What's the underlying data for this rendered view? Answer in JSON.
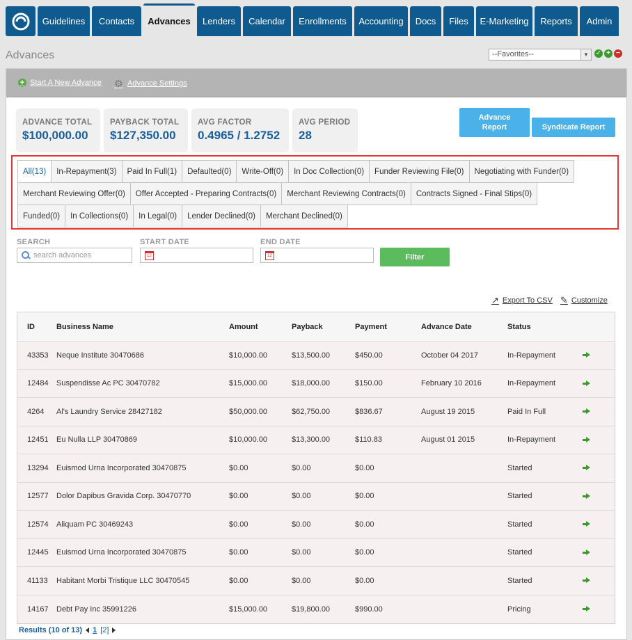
{
  "nav": {
    "tabs": [
      {
        "label": "Guidelines",
        "active": false
      },
      {
        "label": "Contacts",
        "active": false
      },
      {
        "label": "Advances",
        "active": true
      },
      {
        "label": "Lenders",
        "active": false
      },
      {
        "label": "Calendar",
        "active": false
      },
      {
        "label": "Enrollments",
        "active": false
      },
      {
        "label": "Accounting",
        "active": false
      },
      {
        "label": "Docs",
        "active": false
      },
      {
        "label": "Files",
        "active": false
      },
      {
        "label": "E-Marketing",
        "active": false
      },
      {
        "label": "Reports",
        "active": false
      },
      {
        "label": "Admin",
        "active": false
      }
    ]
  },
  "page": {
    "title": "Advances",
    "favorites_value": "--Favorites--"
  },
  "subbar": {
    "start_advance": "Start A New Advance",
    "advance_settings": "Advance Settings"
  },
  "stats": [
    {
      "label": "ADVANCE TOTAL",
      "value": "$100,000.00"
    },
    {
      "label": "PAYBACK TOTAL",
      "value": "$127,350.00"
    },
    {
      "label": "AVG FACTOR",
      "value": "0.4965 / 1.2752"
    },
    {
      "label": "AVG PERIOD",
      "value": "28"
    }
  ],
  "buttons": {
    "advance_report": "Advance Report",
    "syndicate_report": "Syndicate Report",
    "filter": "Filter"
  },
  "status_tabs": {
    "row1": [
      "All(13)",
      "In-Repayment(3)",
      "Paid In Full(1)",
      "Defaulted(0)",
      "Write-Off(0)",
      "In Doc Collection(0)",
      "Funder Reviewing File(0)",
      "Negotiating with Funder(0)"
    ],
    "row2": [
      "Merchant Reviewing Offer(0)",
      "Offer Accepted - Preparing Contracts(0)",
      "Merchant Reviewing Contracts(0)",
      "Contracts Signed - Final Stips(0)"
    ],
    "row3": [
      "Funded(0)",
      "In Collections(0)",
      "In Legal(0)",
      "Lender Declined(0)",
      "Merchant Declined(0)"
    ]
  },
  "filters": {
    "search_label": "SEARCH",
    "search_placeholder": "search advances",
    "start_label": "START DATE",
    "end_label": "END DATE"
  },
  "tools": {
    "export": "Export To CSV",
    "customize": "Customize"
  },
  "table": {
    "headers": {
      "id": "ID",
      "business": "Business Name",
      "amount": "Amount",
      "payback": "Payback",
      "payment": "Payment",
      "advance_date": "Advance Date",
      "status": "Status"
    },
    "rows": [
      {
        "id": "43353",
        "business": "Neque Institute 30470686",
        "amount": "$10,000.00",
        "payback": "$13,500.00",
        "payment": "$450.00",
        "date": "October 04 2017",
        "status": "In-Repayment"
      },
      {
        "id": "12484",
        "business": "Suspendisse Ac PC 30470782",
        "amount": "$15,000.00",
        "payback": "$18,000.00",
        "payment": "$150.00",
        "date": "February 10 2016",
        "status": "In-Repayment"
      },
      {
        "id": "4264",
        "business": "Al's Laundry Service 28427182",
        "amount": "$50,000.00",
        "payback": "$62,750.00",
        "payment": "$836.67",
        "date": "August 19 2015",
        "status": "Paid In Full"
      },
      {
        "id": "12451",
        "business": "Eu Nulla LLP 30470869",
        "amount": "$10,000.00",
        "payback": "$13,300.00",
        "payment": "$110.83",
        "date": "August 01 2015",
        "status": "In-Repayment"
      },
      {
        "id": "13294",
        "business": "Euismod Urna Incorporated 30470875",
        "amount": "$0.00",
        "payback": "$0.00",
        "payment": "$0.00",
        "date": "",
        "status": "Started"
      },
      {
        "id": "12577",
        "business": "Dolor Dapibus Gravida Corp. 30470770",
        "amount": "$0.00",
        "payback": "$0.00",
        "payment": "$0.00",
        "date": "",
        "status": "Started"
      },
      {
        "id": "12574",
        "business": "Aliquam PC 30469243",
        "amount": "$0.00",
        "payback": "$0.00",
        "payment": "$0.00",
        "date": "",
        "status": "Started"
      },
      {
        "id": "12445",
        "business": "Euismod Urna Incorporated 30470875",
        "amount": "$0.00",
        "payback": "$0.00",
        "payment": "$0.00",
        "date": "",
        "status": "Started"
      },
      {
        "id": "41133",
        "business": "Habitant Morbi Tristique LLC 30470545",
        "amount": "$0.00",
        "payback": "$0.00",
        "payment": "$0.00",
        "date": "",
        "status": "Started"
      },
      {
        "id": "14167",
        "business": "Debt Pay Inc 35991226",
        "amount": "$15,000.00",
        "payback": "$19,800.00",
        "payment": "$990.00",
        "date": "",
        "status": "Pricing"
      }
    ]
  },
  "pager": {
    "results": "Results (10 of 13)",
    "page1": "1",
    "page2": "[2]"
  }
}
